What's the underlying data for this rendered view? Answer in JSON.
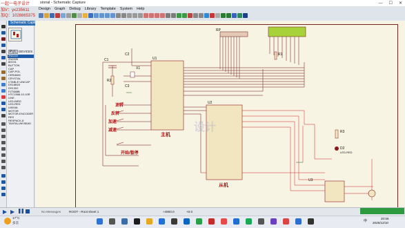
{
  "watermark": {
    "line1": "一起一电子设计",
    "line2": "加V：yx235611",
    "line3": "加Q：1028865375"
  },
  "window": {
    "title": "sional - Schematic Capture",
    "min": "—",
    "max": "☐",
    "close": "✕"
  },
  "menu": [
    "Design",
    "Graph",
    "Debug",
    "Library",
    "Template",
    "System",
    "Help"
  ],
  "panel": {
    "tab_label": "Schematic Capture",
    "p_btn": "P",
    "l_btn": "L",
    "devices_label": "DEVICES",
    "devices": [
      "2N2222",
      "2N2905",
      "80C51",
      "BUTTON",
      "CAP",
      "CAP-POL",
      "CERAMIC",
      "CRYSTAL",
      "CTABLE UNICAP",
      "DS18B20",
      "DS1302",
      "FZT688B",
      "HTC1588-10-10R",
      "LINE",
      "LED-BIRG",
      "LED-RED",
      "LM016L",
      "MOTOR",
      "MOTOR-ENCODER",
      "RES",
      "RESPACK-8",
      "TANTALUM BEAD"
    ],
    "selected_index": 0
  },
  "schematic": {
    "labels": {
      "forward": "正转",
      "reverse": "反转",
      "accelerate": "加速",
      "decelerate": "减速",
      "start_pause": "开始/暂停",
      "master": "主机",
      "slave": "从机"
    },
    "parts": {
      "c1": "C1",
      "r2": "R2",
      "u1": "U1",
      "x1": "X1",
      "c2": "C2",
      "c3": "C3",
      "rp": "RP",
      "r1": "R1",
      "r3": "R3",
      "d2": "D2",
      "u2": "U2",
      "u3": "U3",
      "d2_type": "LED-RED"
    },
    "watermark_overlay": "设计"
  },
  "status": {
    "no_messages": "No Messages",
    "root_sheet": "ROOT - Root sheet 1",
    "x": "+4900.0",
    "y": "+0.0"
  },
  "taskbar": {
    "temp": "17°C",
    "weather": "多云",
    "time": "20:56",
    "date": "2025/12/10",
    "lang": "中"
  },
  "colors": {
    "wire": "#6b0f0f",
    "wire_red": "#d02020",
    "component": "#8a1a1a",
    "chip_fill": "#f2e6c0",
    "lcd_green": "#a8d23a",
    "sheet_bg": "#f7f4e4",
    "accent_blue": "#1c5aa8",
    "status_green": "#2d9a3f"
  }
}
